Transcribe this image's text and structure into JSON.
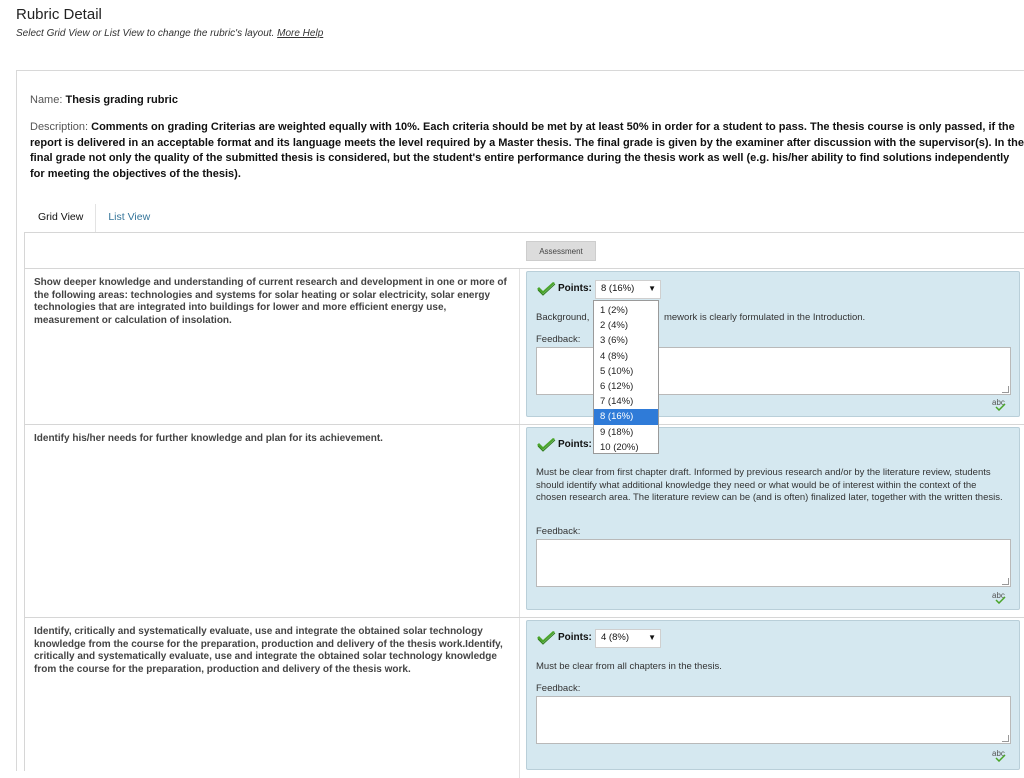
{
  "header": {
    "title": "Rubric Detail",
    "subtitle": "Select Grid View or List View to change the rubric's layout.",
    "help_link": "More Help"
  },
  "rubric": {
    "name_label": "Name:",
    "name": "Thesis grading rubric",
    "description_label": "Description:",
    "description": "Comments on grading Criterias are weighted equally with 10%. Each criteria should be met by at least 50% in order for a student to pass. The thesis course is only passed, if the report is delivered in an acceptable format and its language meets the level required by a Master thesis. The final grade is given by the examiner after discussion with the supervisor(s). In the final grade not only the quality of the submitted thesis is considered, but the student's entire performance during the thesis work as well (e.g. his/her ability to find  solutions independently for meeting the objectives of the thesis)."
  },
  "tabs": [
    {
      "label": "Grid View",
      "active": true
    },
    {
      "label": "List View",
      "active": false
    }
  ],
  "grid": {
    "column_header": "Assessment"
  },
  "criteria": [
    {
      "text": "Show deeper knowledge and understanding of current research and development in one or more of the following areas: technologies and systems for solar heating or solar electricity, solar energy technologies that are integrated into buildings for lower and more efficient energy use, measurement or calculation of insolation.",
      "points_label": "Points:",
      "points_value": "8 (16%)",
      "description_visible_start": "Background,",
      "description_visible_end": "mework is clearly formulated in the Introduction.",
      "feedback_label": "Feedback:"
    },
    {
      "text": "Identify his/her needs for further knowledge and plan for its achievement.",
      "points_label": "Points:",
      "points_value": "",
      "description": "Must be clear from first chapter draft. Informed by previous research and/or by the literature review, students should identify what additional knowledge they need or what would be of interest within the context of the chosen research area. The literature review can be (and is often) finalized later, together with the written thesis.",
      "feedback_label": "Feedback:"
    },
    {
      "text": "Identify, critically and systematically evaluate, use and integrate the obtained solar technology knowledge from the course for the preparation, production and delivery of the thesis work.Identify, critically and systematically evaluate, use and integrate the obtained solar technology knowledge from the course for the preparation, production and delivery of the thesis work.",
      "points_label": "Points:",
      "points_value": "4 (8%)",
      "description": "Must be clear from all chapters in the thesis.",
      "feedback_label": "Feedback:"
    }
  ],
  "points_dropdown": {
    "options": [
      "1 (2%)",
      "2 (4%)",
      "3 (6%)",
      "4 (8%)",
      "5 (10%)",
      "6 (12%)",
      "7 (14%)",
      "8 (16%)",
      "9 (18%)",
      "10 (20%)"
    ],
    "selected": "8 (16%)"
  },
  "icons": {
    "check": "check-icon",
    "spellcheck": "spellcheck-icon",
    "dropdown_arrow": "chevron-down-icon"
  },
  "colors": {
    "panel_bg": "#d5e8f0",
    "selected_option": "#2f7bd8",
    "check_green": "#4aa52a"
  }
}
